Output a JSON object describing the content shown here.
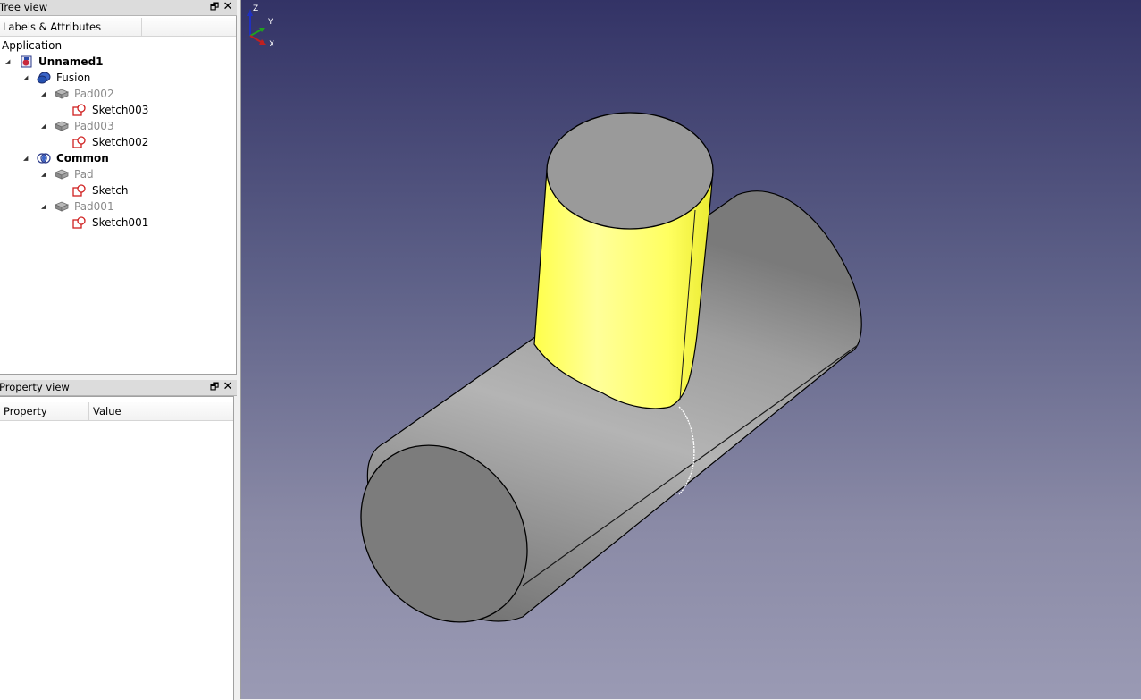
{
  "tree_view": {
    "title": "Tree view",
    "column_header": "Labels & Attributes",
    "root_label": "Application",
    "items": [
      {
        "label": "Unnamed1",
        "icon": "document-icon"
      },
      {
        "label": "Fusion",
        "icon": "fusion-icon"
      },
      {
        "label": "Pad002",
        "icon": "pad-icon"
      },
      {
        "label": "Sketch003",
        "icon": "sketch-icon"
      },
      {
        "label": "Pad003",
        "icon": "pad-icon"
      },
      {
        "label": "Sketch002",
        "icon": "sketch-icon"
      },
      {
        "label": "Common",
        "icon": "common-icon"
      },
      {
        "label": "Pad",
        "icon": "pad-icon"
      },
      {
        "label": "Sketch",
        "icon": "sketch-icon"
      },
      {
        "label": "Pad001",
        "icon": "pad-icon"
      },
      {
        "label": "Sketch001",
        "icon": "sketch-icon"
      }
    ]
  },
  "property_view": {
    "title": "Property view",
    "columns": [
      "Property",
      "Value"
    ]
  },
  "axis_labels": {
    "z": "Z",
    "y": "Y",
    "x": "X"
  },
  "colors": {
    "viewport_top": "#333366",
    "viewport_bottom": "#9a9ab4",
    "selected_face": "#ffff66",
    "solid_grey": "#a8a8a8"
  }
}
